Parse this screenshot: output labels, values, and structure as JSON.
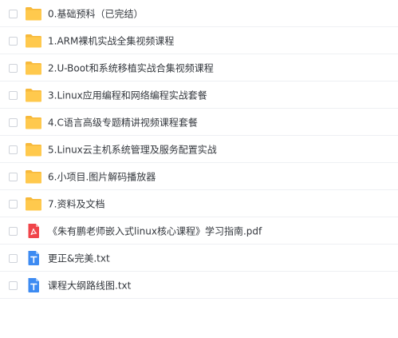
{
  "files": [
    {
      "name": "0.基础预科（已完结）",
      "type": "folder",
      "icon": "folder-icon"
    },
    {
      "name": "1.ARM裸机实战全集视频课程",
      "type": "folder",
      "icon": "folder-icon"
    },
    {
      "name": "2.U-Boot和系统移植实战合集视频课程",
      "type": "folder",
      "icon": "folder-icon"
    },
    {
      "name": "3.Linux应用编程和网络编程实战套餐",
      "type": "folder",
      "icon": "folder-icon"
    },
    {
      "name": "4.C语言高级专题精讲视频课程套餐",
      "type": "folder",
      "icon": "folder-icon"
    },
    {
      "name": "5.Linux云主机系统管理及服务配置实战",
      "type": "folder",
      "icon": "folder-icon"
    },
    {
      "name": "6.小项目.图片解码播放器",
      "type": "folder",
      "icon": "folder-icon"
    },
    {
      "name": "7.资料及文档",
      "type": "folder",
      "icon": "folder-icon"
    },
    {
      "name": "《朱有鹏老师嵌入式linux核心课程》学习指南.pdf",
      "type": "pdf",
      "icon": "pdf-file-icon"
    },
    {
      "name": "更正&完美.txt",
      "type": "txt",
      "icon": "text-file-icon"
    },
    {
      "name": "课程大纲路线图.txt",
      "type": "txt",
      "icon": "text-file-icon"
    }
  ],
  "colors": {
    "folder": "#ffc94d",
    "folder_tab": "#f7b93b",
    "pdf": "#f0454a",
    "txt": "#3d8bf2"
  }
}
